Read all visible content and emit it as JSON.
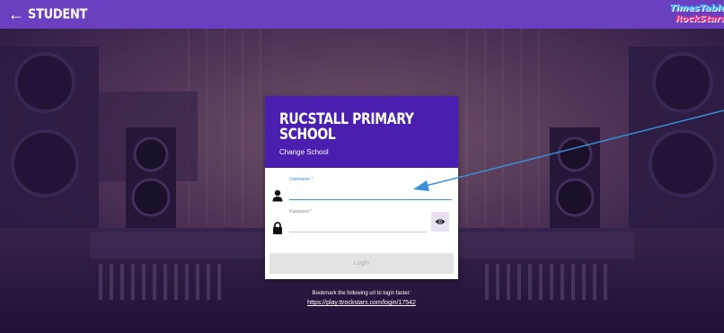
{
  "topbar": {
    "back_label": "STUDENT",
    "logo_line1": "TimesTables",
    "logo_line2": "RockStars"
  },
  "card": {
    "school_name": "RUCSTALL PRIMARY SCHOOL",
    "change_school": "Change School",
    "username": {
      "label": "Username *",
      "value": ""
    },
    "password": {
      "label": "Password *",
      "value": ""
    },
    "login_label": "Login"
  },
  "bookmark": {
    "text": "Bookmark the following url to login faster:",
    "url": "https://play.ttrockstars.com/login/17542"
  },
  "colors": {
    "topbar": "#6a3fc0",
    "card_header": "#4a1fb0",
    "focus_line": "#3b8fd6",
    "annotation_arrow": "#3b8fd6"
  },
  "icons": [
    "back-arrow-icon",
    "user-icon",
    "lock-icon",
    "eye-icon"
  ]
}
